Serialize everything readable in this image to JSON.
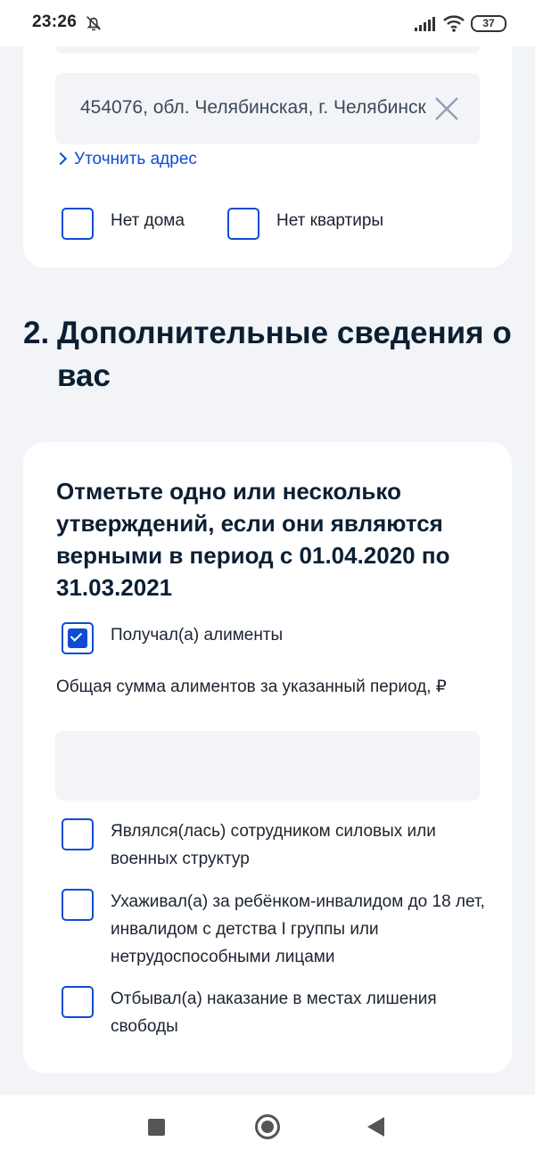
{
  "status_bar": {
    "time": "23:26",
    "battery": "37",
    "icons": [
      "bell-off-icon",
      "signal-icon",
      "wifi-icon",
      "battery-icon"
    ]
  },
  "address": {
    "value": "454076, обл. Челябинская, г. Челябинск",
    "clear_icon": "close-icon",
    "refine_link": "Уточнить адрес",
    "options": [
      {
        "label": "Нет дома",
        "checked": false
      },
      {
        "label": "Нет квартиры",
        "checked": false
      }
    ]
  },
  "section2": {
    "number": "2.",
    "title": "Дополнительные сведения о вас",
    "question": "Отметьте одно или несколько утверждений, если они являются верными в период с 01.04.2020 по 31.03.2021",
    "statements": [
      {
        "label": "Получал(а) алименты",
        "checked": true
      },
      {
        "label": "Являлся(лась) сотрудником силовых или военных структур",
        "checked": false
      },
      {
        "label": "Ухаживал(а) за ребёнком-инвалидом до 18 лет, инвалидом с детства I группы или нетрудоспособными лицами",
        "checked": false
      },
      {
        "label": "Отбывал(а) наказание в местах лишения свободы",
        "checked": false
      }
    ],
    "alimony_sum_label": "Общая сумма алиментов за указанный период, ₽",
    "alimony_sum_value": ""
  },
  "nav_bar": {
    "buttons": [
      "recents-button",
      "home-button",
      "back-button"
    ]
  },
  "colors": {
    "accent": "#0d4cd3",
    "background": "#f2f4f7",
    "card": "#ffffff",
    "text": "#0b1f33"
  }
}
